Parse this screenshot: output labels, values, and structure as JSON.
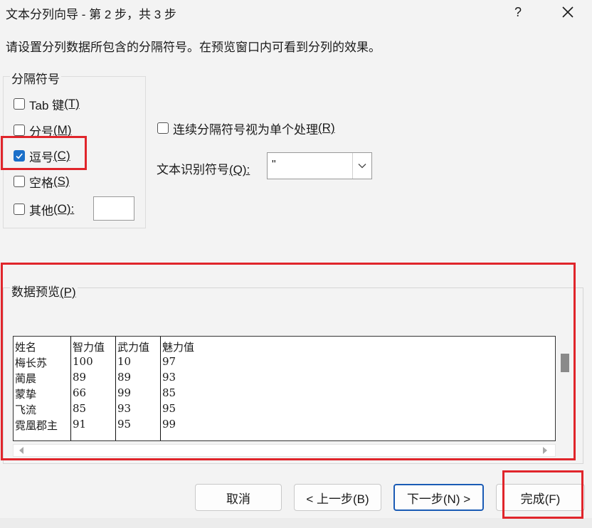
{
  "window": {
    "title": "文本分列向导 - 第 2 步，共 3 步",
    "help_label": "?"
  },
  "instruction": "请设置分列数据所包含的分隔符号。在预览窗口内可看到分列的效果。",
  "delimiters": {
    "legend": "分隔符号",
    "tab": {
      "label": "Tab 键",
      "key": "(T)",
      "checked": false
    },
    "semicolon": {
      "label": "分号",
      "key": "(M)",
      "checked": false
    },
    "comma": {
      "label": "逗号",
      "key": "(C)",
      "checked": true
    },
    "space": {
      "label": "空格",
      "key": "(S)",
      "checked": false
    },
    "other": {
      "label": "其他",
      "key": "(O):",
      "checked": false,
      "value": ""
    }
  },
  "consecutive": {
    "label": "连续分隔符号视为单个处理",
    "key": "(R)",
    "checked": false
  },
  "text_qualifier": {
    "label": "文本识别符号",
    "key": "(Q):",
    "value": "\""
  },
  "preview": {
    "label": "数据预览",
    "key": "(P)",
    "columns": [
      [
        "姓名",
        "梅长苏",
        "蔺晨",
        "蒙挚",
        "飞流",
        "霓凰郡主"
      ],
      [
        "智力值",
        "100",
        "89",
        "66",
        "85",
        "91"
      ],
      [
        "武力值",
        "10",
        "89",
        "99",
        "93",
        "95"
      ],
      [
        "魅力值",
        "97",
        "93",
        "85",
        "95",
        "99"
      ]
    ]
  },
  "buttons": {
    "cancel": "取消",
    "back": "< 上一步(B)",
    "next": "下一步(N) >",
    "finish": "完成(F)"
  },
  "colors": {
    "highlight": "#e0252b",
    "check_accent": "#1a6fc9",
    "primary_border": "#1a5bb5"
  }
}
